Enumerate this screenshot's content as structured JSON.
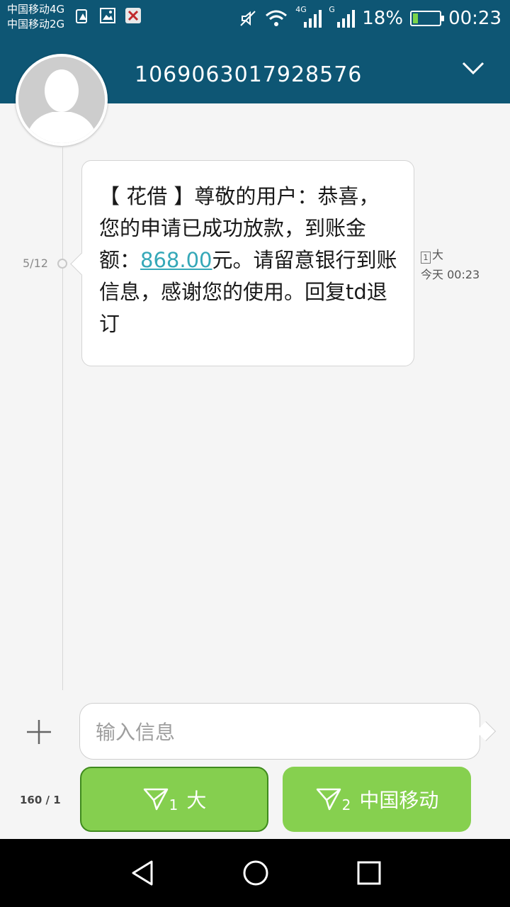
{
  "status_bar": {
    "carrier_1": "中国移动4G",
    "carrier_2": "中国移动2G",
    "net_tag_1": "4G",
    "net_tag_2": "G",
    "battery": "18%",
    "time": "00:23",
    "battery_level_percent": 18
  },
  "header": {
    "title": "1069063017928576"
  },
  "conversation": {
    "date": "5/12",
    "message": {
      "prefix": "【 花借 】尊敬的用户：恭喜，您的申请已成功放款，到账金额：",
      "amount": "868.00",
      "suffix": "元。请留意银行到账信息，感谢您的使用。回复td退订",
      "sim_badge": "1",
      "sim_name": "大",
      "timestamp": "今天 00:23"
    }
  },
  "composer": {
    "placeholder": "输入信息",
    "char_count": "160 / 1",
    "send_1": {
      "sub": "1",
      "label": "大"
    },
    "send_2": {
      "sub": "2",
      "label": "中国移动"
    }
  },
  "colors": {
    "header": "#0e5674",
    "send_button": "#85cf4f",
    "link": "#35a8b8"
  }
}
